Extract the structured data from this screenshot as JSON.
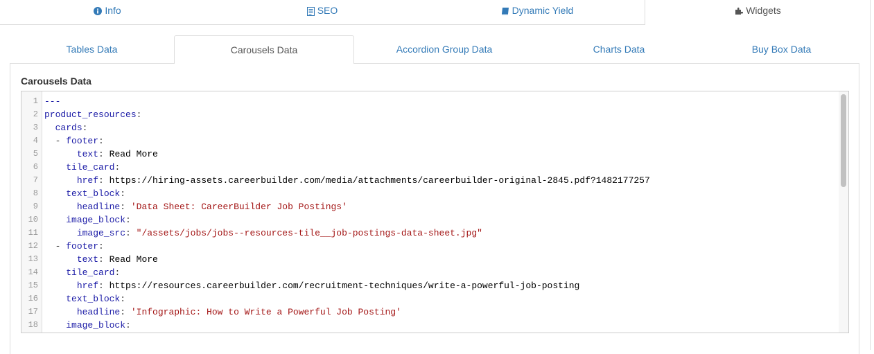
{
  "top_tabs": [
    {
      "label": "Info",
      "icon": "info-circle-icon"
    },
    {
      "label": "SEO",
      "icon": "document-icon"
    },
    {
      "label": "Dynamic Yield",
      "icon": "book-icon"
    },
    {
      "label": "Widgets",
      "icon": "puzzle-icon",
      "active": true
    }
  ],
  "sub_tabs": [
    {
      "label": "Tables Data"
    },
    {
      "label": "Carousels Data",
      "active": true
    },
    {
      "label": "Accordion Group Data"
    },
    {
      "label": "Charts Data"
    },
    {
      "label": "Buy Box Data"
    }
  ],
  "panel": {
    "label": "Carousels Data"
  },
  "editor": {
    "line_numbers": [
      "1",
      "2",
      "3",
      "4",
      "5",
      "6",
      "7",
      "8",
      "9",
      "10",
      "11",
      "12",
      "13",
      "14",
      "15",
      "16",
      "17",
      "18"
    ],
    "lines": [
      {
        "indent": "",
        "key": "---",
        "value": ""
      },
      {
        "indent": "",
        "key": "product_resources",
        "value": ""
      },
      {
        "indent": "  ",
        "key": "cards",
        "value": ""
      },
      {
        "indent": "  - ",
        "key": "footer",
        "value": ""
      },
      {
        "indent": "      ",
        "key": "text",
        "value": "Read More"
      },
      {
        "indent": "    ",
        "key": "tile_card",
        "value": ""
      },
      {
        "indent": "      ",
        "key": "href",
        "value": "https://hiring-assets.careerbuilder.com/media/attachments/careerbuilder-original-2845.pdf?1482177257"
      },
      {
        "indent": "    ",
        "key": "text_block",
        "value": ""
      },
      {
        "indent": "      ",
        "key": "headline",
        "value": "'Data Sheet: CareerBuilder Job Postings'"
      },
      {
        "indent": "    ",
        "key": "image_block",
        "value": ""
      },
      {
        "indent": "      ",
        "key": "image_src",
        "value": "\"/assets/jobs/jobs--resources-tile__job-postings-data-sheet.jpg\""
      },
      {
        "indent": "  - ",
        "key": "footer",
        "value": ""
      },
      {
        "indent": "      ",
        "key": "text",
        "value": "Read More"
      },
      {
        "indent": "    ",
        "key": "tile_card",
        "value": ""
      },
      {
        "indent": "      ",
        "key": "href",
        "value": "https://resources.careerbuilder.com/recruitment-techniques/write-a-powerful-job-posting"
      },
      {
        "indent": "    ",
        "key": "text_block",
        "value": ""
      },
      {
        "indent": "      ",
        "key": "headline",
        "value": "'Infographic: How to Write a Powerful Job Posting'"
      },
      {
        "indent": "    ",
        "key": "image_block",
        "value": ""
      }
    ]
  }
}
